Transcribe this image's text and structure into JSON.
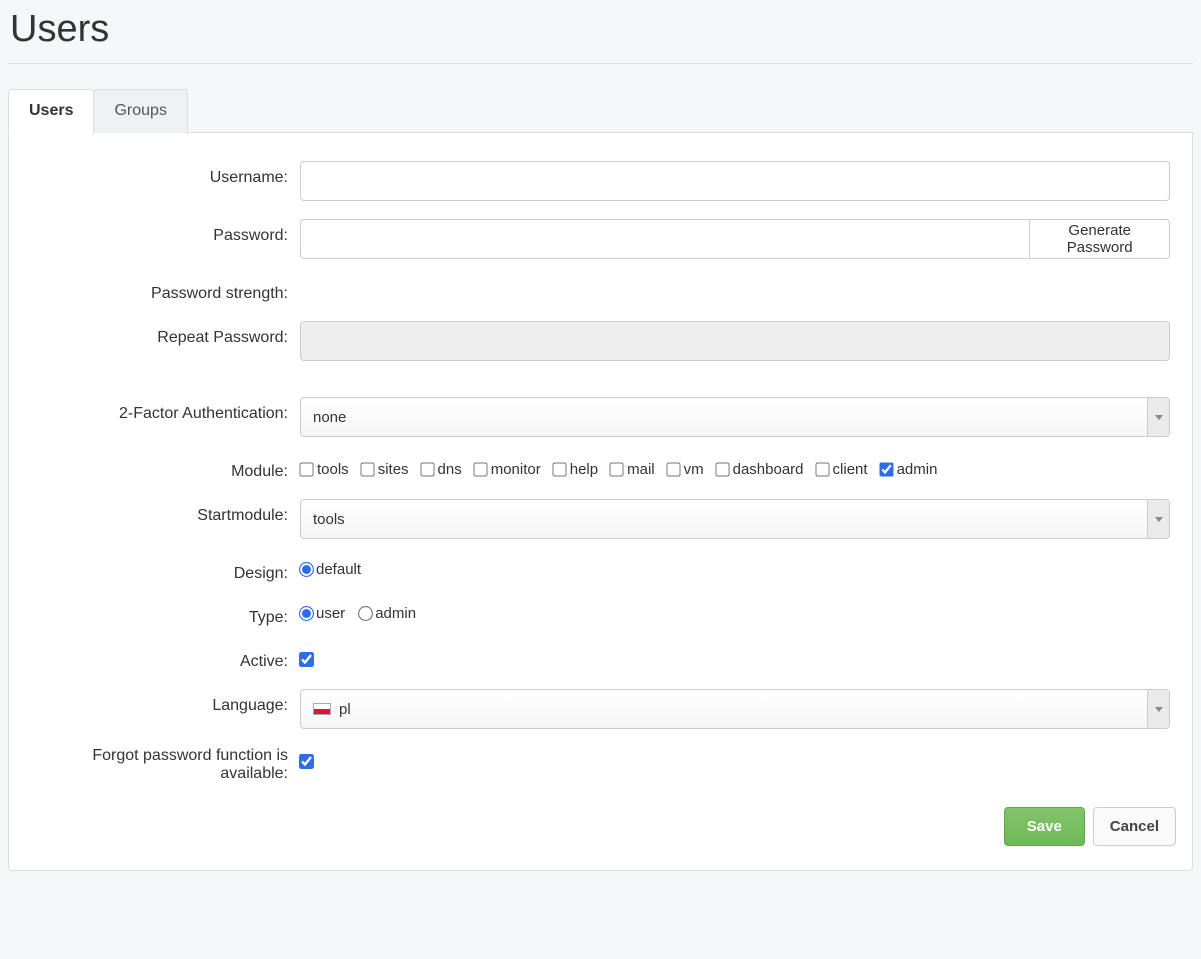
{
  "page": {
    "title": "Users"
  },
  "tabs": {
    "users": "Users",
    "groups": "Groups",
    "active": "users"
  },
  "form": {
    "username": {
      "label": "Username:",
      "value": ""
    },
    "password": {
      "label": "Password:",
      "value": "",
      "generate_label": "Generate Password"
    },
    "password_strength": {
      "label": "Password strength:"
    },
    "repeat_password": {
      "label": "Repeat Password:",
      "value": ""
    },
    "two_factor": {
      "label": "2-Factor Authentication:",
      "selected": "none"
    },
    "module": {
      "label": "Module:",
      "items": [
        {
          "key": "tools",
          "label": "tools",
          "checked": false
        },
        {
          "key": "sites",
          "label": "sites",
          "checked": false
        },
        {
          "key": "dns",
          "label": "dns",
          "checked": false
        },
        {
          "key": "monitor",
          "label": "monitor",
          "checked": false
        },
        {
          "key": "help",
          "label": "help",
          "checked": false
        },
        {
          "key": "mail",
          "label": "mail",
          "checked": false
        },
        {
          "key": "vm",
          "label": "vm",
          "checked": false
        },
        {
          "key": "dashboard",
          "label": "dashboard",
          "checked": false
        },
        {
          "key": "client",
          "label": "client",
          "checked": false
        },
        {
          "key": "admin",
          "label": "admin",
          "checked": true
        }
      ]
    },
    "startmodule": {
      "label": "Startmodule:",
      "selected": "tools"
    },
    "design": {
      "label": "Design:",
      "options": [
        {
          "key": "default",
          "label": "default",
          "checked": true
        }
      ]
    },
    "type": {
      "label": "Type:",
      "options": [
        {
          "key": "user",
          "label": "user",
          "checked": true
        },
        {
          "key": "admin",
          "label": "admin",
          "checked": false
        }
      ]
    },
    "active": {
      "label": "Active:",
      "checked": true
    },
    "language": {
      "label": "Language:",
      "selected": "pl",
      "flag": "pl"
    },
    "forgot_password": {
      "label": "Forgot password function is available:",
      "checked": true
    }
  },
  "actions": {
    "save": "Save",
    "cancel": "Cancel"
  }
}
